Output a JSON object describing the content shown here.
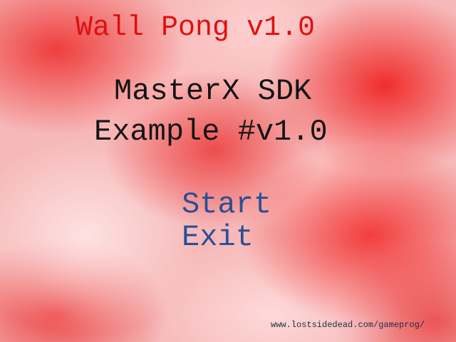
{
  "game": {
    "title": "Wall Pong v1.0",
    "subtitle_line1": "MasterX SDK",
    "subtitle_line2": "Example #v1.0"
  },
  "menu": {
    "items": [
      {
        "label": "Start"
      },
      {
        "label": "Exit"
      }
    ]
  },
  "footer": {
    "url": "www.lostsidedead.com/gameprog/"
  },
  "colors": {
    "title": "#e01010",
    "subtitle": "#141414",
    "menu": "#2a4f96",
    "background_base": "#f6b8b8",
    "background_cloud_dark": "#ee2828"
  }
}
